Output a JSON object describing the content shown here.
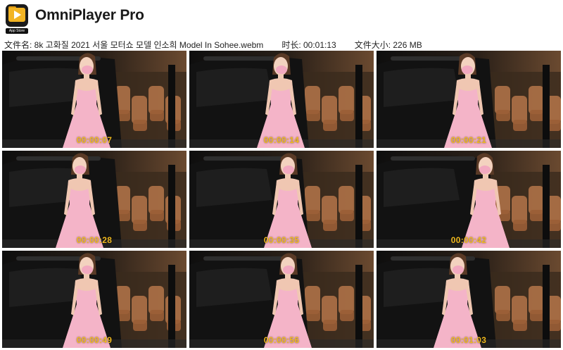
{
  "app": {
    "title": "OmniPlayer Pro",
    "store_badge": "App Store",
    "logo_icon": "omniplayer-logo-icon"
  },
  "meta": {
    "file_name": "文件名: 8k 고화질 2021 서울 모터쇼 모델 인소희 Model In Sohee.webm",
    "duration": "时长: 00:01:13",
    "file_size": "文件大小: 226 MB"
  },
  "colors": {
    "timestamp": "#f0b91e",
    "dress": "#f4b4c8",
    "car": "#121212",
    "seat": "#b5764a"
  },
  "thumbnails": [
    {
      "time": "00:00:07"
    },
    {
      "time": "00:00:14"
    },
    {
      "time": "00:00:21"
    },
    {
      "time": "00:00:28"
    },
    {
      "time": "00:00:35"
    },
    {
      "time": "00:00:42"
    },
    {
      "time": "00:00:49"
    },
    {
      "time": "00:00:56"
    },
    {
      "time": "00:01:03"
    }
  ]
}
